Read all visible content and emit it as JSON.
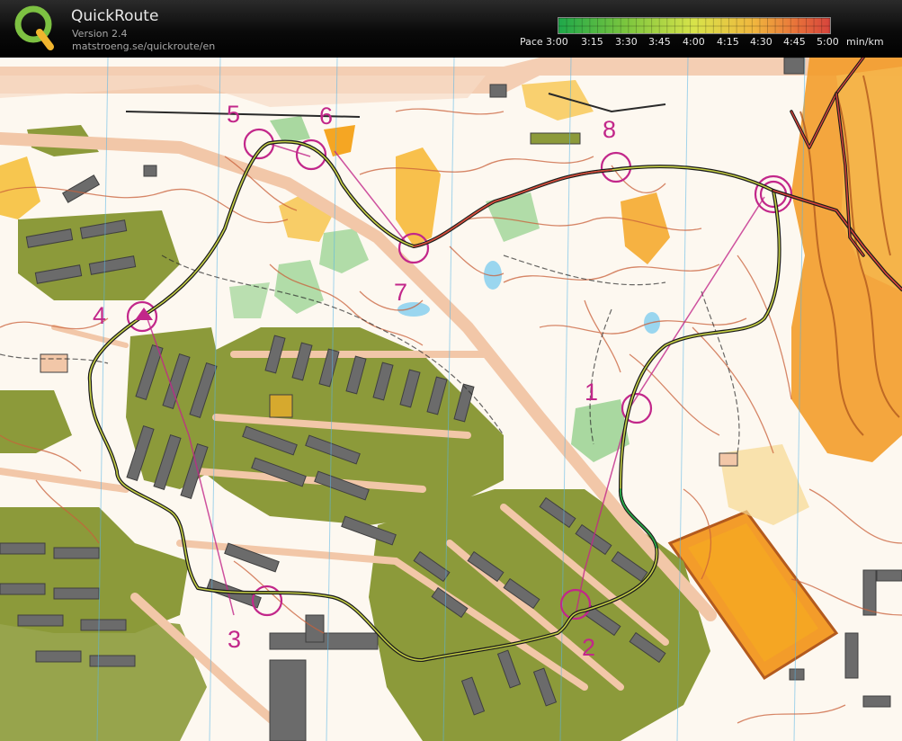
{
  "app": {
    "title": "QuickRoute",
    "version": "Version 2.4",
    "url": "matstroeng.se/quickroute/en"
  },
  "pace_legend": {
    "label": "Pace",
    "ticks": [
      "3:00",
      "3:15",
      "3:30",
      "3:45",
      "4:00",
      "4:15",
      "4:30",
      "4:45",
      "5:00"
    ],
    "unit": "min/km",
    "colors": [
      "#1ea84a",
      "#7cc63e",
      "#d8e34a",
      "#f0b63e",
      "#e8703a",
      "#d6443c"
    ]
  },
  "map": {
    "control_labels": [
      "1",
      "2",
      "3",
      "4",
      "5",
      "6",
      "7",
      "8"
    ],
    "colors": {
      "paper": "#fdf8f0",
      "forest_green": "#8c9a3a",
      "open_yellow": "#f5a623",
      "rough_orange": "#f39c2a",
      "building": "#6b6b6b",
      "paved": "#f2c7a8",
      "course": "#c2278a",
      "contour": "#c9603a",
      "route": "#1a1a1a"
    }
  }
}
